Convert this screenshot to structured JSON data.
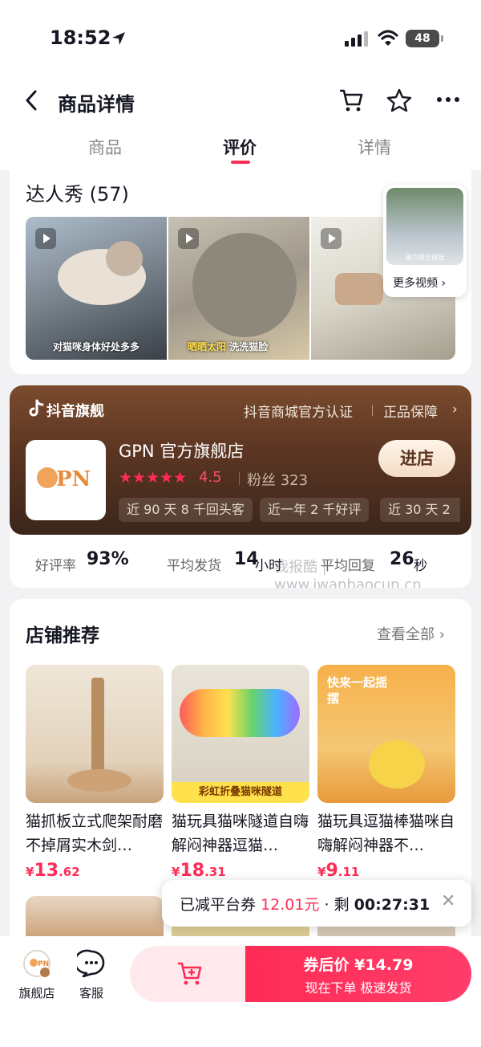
{
  "status": {
    "time": "18:52",
    "battery": "48"
  },
  "nav": {
    "title": "商品详情"
  },
  "tabs": [
    "商品",
    "评价",
    "详情"
  ],
  "influencer": {
    "title": "达人秀 (57)",
    "videos": [
      {
        "caption": "对猫咪身体好处多多"
      },
      {
        "caption_a": "晒晒太阳",
        "caption_b": "洗洗猫脸"
      },
      {
        "caption": ""
      }
    ],
    "more_thumb_caption": "磁力吸合窗挂",
    "more_label": "更多视频 ›"
  },
  "store": {
    "platform_label": "抖音旗舰",
    "cert": "抖音商城官方认证",
    "guarantee": "正品保障",
    "logo_text": "PN",
    "name": "GPN 官方旗舰店",
    "stars": "★★★★★",
    "rating": "4.5",
    "fans_label": "粉丝 323",
    "chips": [
      "近 90 天 8 千回头客",
      "近一年 2 千好评",
      "近 30 天 2"
    ],
    "enter_label": "进店",
    "stats": {
      "good_rate_label": "好评率",
      "good_rate_value": "93%",
      "ship_label": "平均发货",
      "ship_value": "14",
      "ship_unit": "小时",
      "reply_label": "平均回复",
      "reply_value": "26",
      "reply_unit": "秒"
    },
    "watermark": "我报酷 | www.iwanbaocun.cn"
  },
  "recommend": {
    "title": "店铺推荐",
    "view_all": "查看全部 ›",
    "products": [
      {
        "name": "猫抓板立式爬架耐磨不掉屑实木剑…",
        "price_int": "13",
        "price_dec": ".62"
      },
      {
        "name": "猫玩具猫咪隧道自嗨解闷神器逗猫…",
        "price_int": "18",
        "price_dec": ".31",
        "banner": "彩虹折叠猫咪隧道"
      },
      {
        "name": "猫玩具逗猫棒猫咪自嗨解闷神器不…",
        "price_int": "9",
        "price_dec": ".11",
        "banner": "快来一起摇摆"
      }
    ],
    "price_symbol": "¥"
  },
  "toast": {
    "prefix": "已减平台券",
    "amount": "12.01元",
    "suffix": "· 剩",
    "countdown": "00:27:31"
  },
  "bottom": {
    "shop_label": "旗舰店",
    "service_label": "客服",
    "buy_line1": "券后价 ¥14.79",
    "buy_line2": "现在下单  极速发货"
  },
  "colors": {
    "accent": "#fe2c55",
    "store_bg": "#5b3522"
  }
}
